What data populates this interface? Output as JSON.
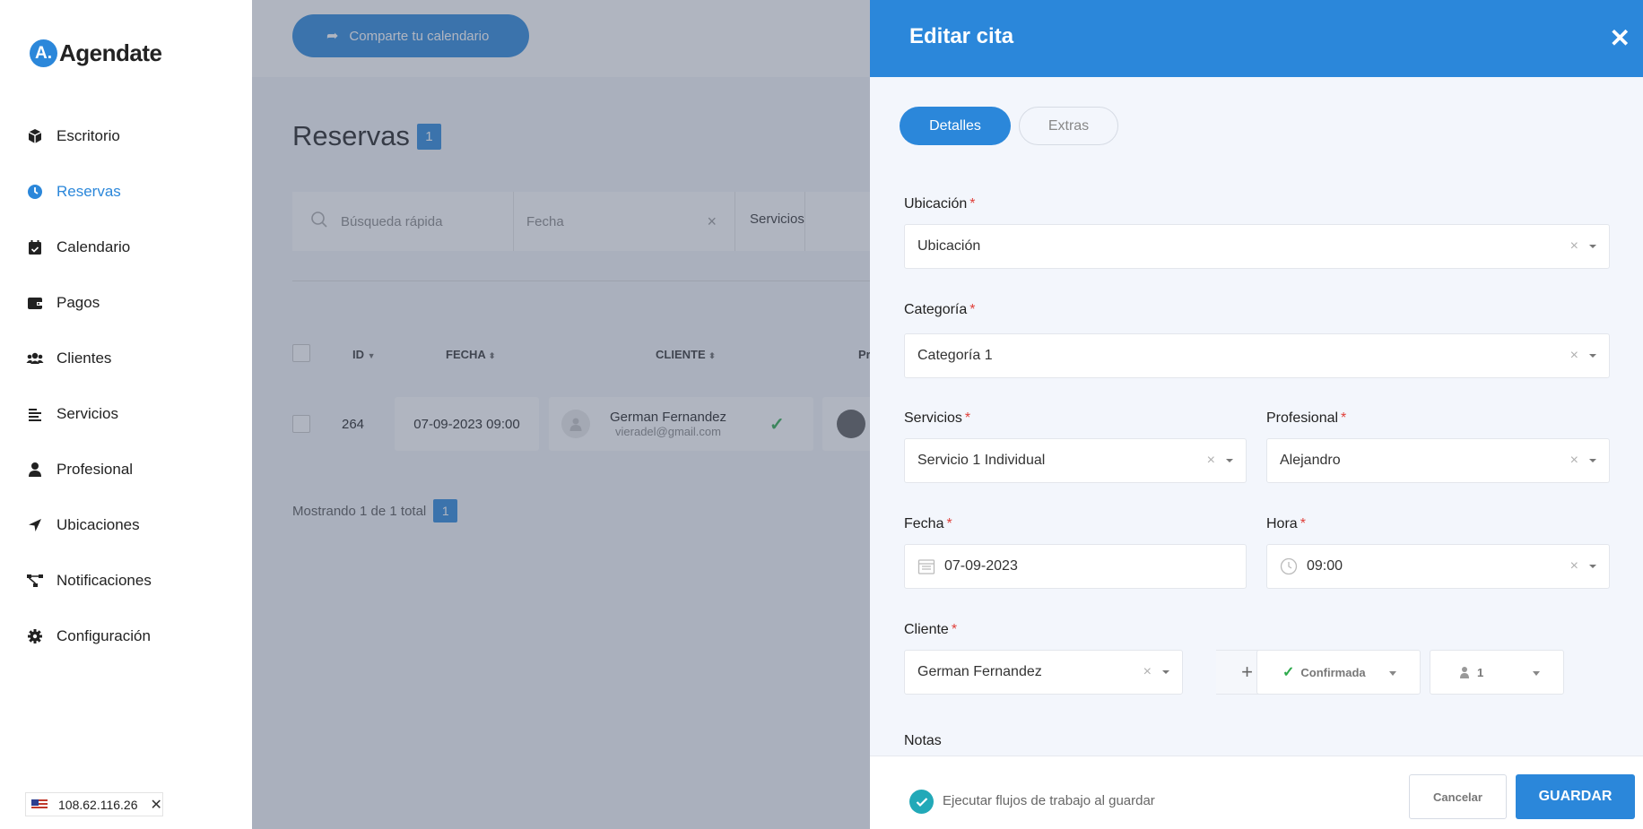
{
  "brand": {
    "logo_letter": "A.",
    "name": "Agendate",
    "accent": "#2b87da"
  },
  "sidebar": {
    "items": [
      {
        "label": "Escritorio",
        "icon": "box-icon"
      },
      {
        "label": "Reservas",
        "icon": "clock-icon",
        "active": true
      },
      {
        "label": "Calendario",
        "icon": "calendar-check-icon"
      },
      {
        "label": "Pagos",
        "icon": "wallet-icon"
      },
      {
        "label": "Clientes",
        "icon": "users-icon"
      },
      {
        "label": "Servicios",
        "icon": "list-icon"
      },
      {
        "label": "Profesional",
        "icon": "user-icon"
      },
      {
        "label": "Ubicaciones",
        "icon": "location-arrow-icon"
      },
      {
        "label": "Notificaciones",
        "icon": "workflow-icon"
      },
      {
        "label": "Configuración",
        "icon": "gear-icon"
      }
    ],
    "ip_badge": {
      "ip": "108.62.116.26",
      "close": "✕"
    }
  },
  "main": {
    "share_button": "Comparte tu calendario",
    "title": "Reservas",
    "count": "1",
    "filters": {
      "search_placeholder": "Búsqueda rápida",
      "date_placeholder": "Fecha",
      "date_clear": "×",
      "services": "Servicios"
    },
    "table": {
      "headers": {
        "id": "ID",
        "fecha": "FECHA",
        "cliente": "CLIENTE",
        "profesional": "Pr"
      },
      "rows": [
        {
          "id": "264",
          "fecha": "07-09-2023 09:00",
          "cliente_nombre": "German Fernandez",
          "cliente_email": "vieradel@gmail.com"
        }
      ]
    },
    "pagination": {
      "text": "Mostrando 1 de 1 total",
      "page": "1"
    }
  },
  "drawer": {
    "title": "Editar cita",
    "close": "✕",
    "tabs": {
      "details": "Detalles",
      "extras": "Extras"
    },
    "ubicacion": {
      "label": "Ubicación",
      "value": "Ubicación"
    },
    "categoria": {
      "label": "Categoría",
      "value": "Categoría 1"
    },
    "servicios": {
      "label": "Servicios",
      "value": "Servicio 1 Individual"
    },
    "profesional": {
      "label": "Profesional",
      "value": "Alejandro"
    },
    "fecha": {
      "label": "Fecha",
      "value": "07-09-2023"
    },
    "hora": {
      "label": "Hora",
      "value": "09:00"
    },
    "cliente": {
      "label": "Cliente",
      "value": "German Fernandez",
      "add": "+"
    },
    "estado": {
      "value": "Confirmada"
    },
    "personas": {
      "value": "1"
    },
    "notas": {
      "label": "Notas"
    },
    "required_mark": "*",
    "clear_mark": "×",
    "footer": {
      "workflow_label": "Ejecutar flujos de trabajo al guardar",
      "cancel": "Cancelar",
      "save": "GUARDAR"
    }
  }
}
